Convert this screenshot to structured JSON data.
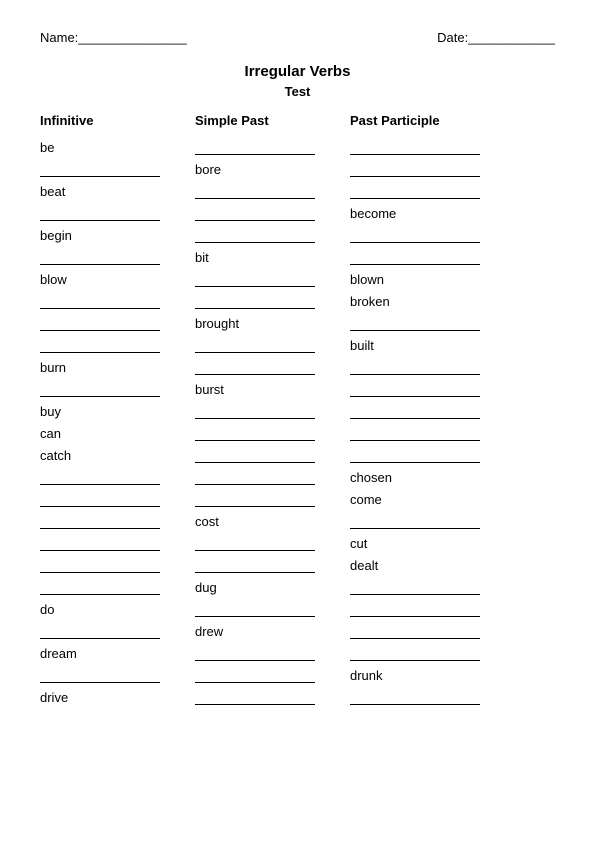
{
  "header": {
    "name_label": "Name:",
    "name_line": "_______________",
    "date_label": "Date:",
    "date_line": "____________"
  },
  "title": "Irregular Verbs",
  "subtitle": "Test",
  "columns": {
    "infinitive": "Infinitive",
    "simple_past": "Simple Past",
    "past_participle": "Past Participle"
  },
  "rows": [
    {
      "inf": "be",
      "sp": "",
      "pp": ""
    },
    {
      "inf": "",
      "sp": "bore",
      "pp": ""
    },
    {
      "inf": "beat",
      "sp": "",
      "pp": ""
    },
    {
      "inf": "",
      "sp": "",
      "pp": "become"
    },
    {
      "inf": "begin",
      "sp": "",
      "pp": ""
    },
    {
      "inf": "",
      "sp": "bit",
      "pp": ""
    },
    {
      "inf": "blow",
      "sp": "",
      "pp": "blown"
    },
    {
      "inf": "",
      "sp": "",
      "pp": "broken"
    },
    {
      "inf": "",
      "sp": "brought",
      "pp": ""
    },
    {
      "inf": "",
      "sp": "",
      "pp": "built"
    },
    {
      "inf": "burn",
      "sp": "",
      "pp": ""
    },
    {
      "inf": "",
      "sp": "burst",
      "pp": ""
    },
    {
      "inf": "buy",
      "sp": "",
      "pp": ""
    },
    {
      "inf": "can",
      "sp": "",
      "pp": ""
    },
    {
      "inf": "catch",
      "sp": "",
      "pp": ""
    },
    {
      "inf": "",
      "sp": "",
      "pp": "chosen"
    },
    {
      "inf": "",
      "sp": "",
      "pp": "come"
    },
    {
      "inf": "",
      "sp": "cost",
      "pp": ""
    },
    {
      "inf": "",
      "sp": "",
      "pp": "cut"
    },
    {
      "inf": "",
      "sp": "",
      "pp": "dealt"
    },
    {
      "inf": "",
      "sp": "dug",
      "pp": ""
    },
    {
      "inf": "do",
      "sp": "",
      "pp": ""
    },
    {
      "inf": "",
      "sp": "drew",
      "pp": ""
    },
    {
      "inf": "dream",
      "sp": "",
      "pp": ""
    },
    {
      "inf": "",
      "sp": "",
      "pp": "drunk"
    },
    {
      "inf": "drive",
      "sp": "",
      "pp": ""
    }
  ]
}
